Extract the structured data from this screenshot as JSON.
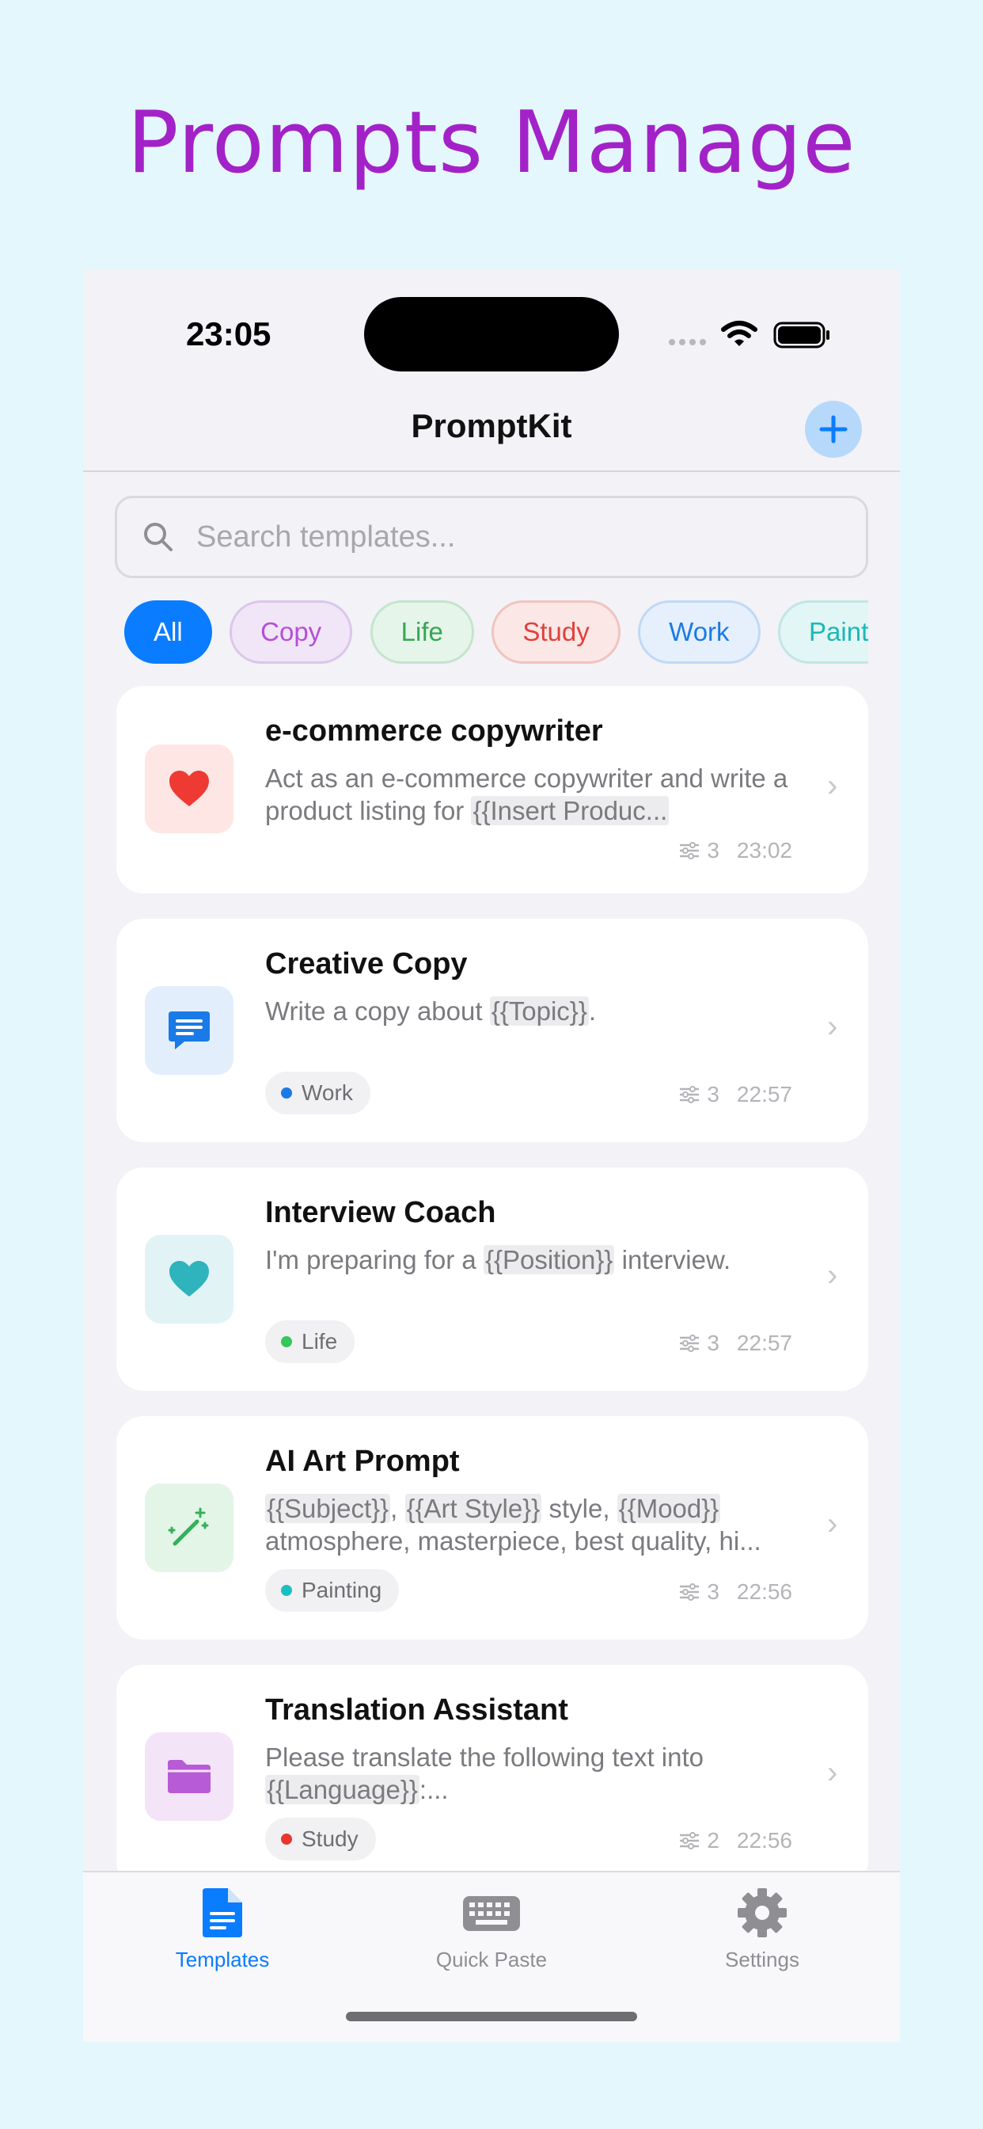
{
  "hero_title": "Prompts Manage",
  "status": {
    "time": "23:05"
  },
  "nav": {
    "title": "PromptKit"
  },
  "search": {
    "placeholder": "Search templates..."
  },
  "filters": [
    {
      "label": "All",
      "active": true
    },
    {
      "label": "Copy",
      "color": "#b44fd8",
      "bg": "#f1e6f7",
      "border": "#dcc6ea"
    },
    {
      "label": "Life",
      "color": "#34a853",
      "bg": "#e6f5ea",
      "border": "#c3e5cc"
    },
    {
      "label": "Study",
      "color": "#e0413a",
      "bg": "#fbe7e6",
      "border": "#f0c3c0"
    },
    {
      "label": "Work",
      "color": "#1a7ae6",
      "bg": "#e5f0fc",
      "border": "#c0d9f4"
    },
    {
      "label": "Painting",
      "color": "#1bb8b6",
      "bg": "#e2f6f5",
      "border": "#c0e6e5"
    }
  ],
  "templates": [
    {
      "title": "e-commerce copywriter",
      "desc_parts": [
        {
          "t": "Act as an e-commerce copywriter and write a product listing for "
        },
        {
          "t": "{{Insert Produc...",
          "ph": true
        }
      ],
      "variables": "3",
      "time": "23:02",
      "tag": null,
      "icon": "heart-icon",
      "icon_color": "#ee3a33",
      "icon_bg": "#fde6e4"
    },
    {
      "title": "Creative Copy",
      "desc_parts": [
        {
          "t": "Write a copy about "
        },
        {
          "t": "{{Topic}}",
          "ph": true
        },
        {
          "t": "."
        }
      ],
      "variables": "3",
      "time": "22:57",
      "tag": "Work",
      "tag_color": "#1a7ae6",
      "icon": "message-icon",
      "icon_color": "#1a7ae6",
      "icon_bg": "#e2eefb"
    },
    {
      "title": "Interview Coach",
      "desc_parts": [
        {
          "t": "I'm preparing for a "
        },
        {
          "t": "{{Position}}",
          "ph": true
        },
        {
          "t": " interview."
        }
      ],
      "variables": "3",
      "time": "22:57",
      "tag": "Life",
      "tag_color": "#34c759",
      "icon": "heart-icon",
      "icon_color": "#2fb3bd",
      "icon_bg": "#e1f3f5"
    },
    {
      "title": "AI Art Prompt",
      "desc_parts": [
        {
          "t": "{{Subject}}",
          "ph": true
        },
        {
          "t": ", "
        },
        {
          "t": "{{Art Style}}",
          "ph": true
        },
        {
          "t": " style, "
        },
        {
          "t": "{{Mood}}",
          "ph": true
        },
        {
          "t": " atmosphere, masterpiece, best quality, hi..."
        }
      ],
      "variables": "3",
      "time": "22:56",
      "tag": "Painting",
      "tag_color": "#1bbfbf",
      "icon": "magic-wand-icon",
      "icon_color": "#34b05a",
      "icon_bg": "#e3f5e7"
    },
    {
      "title": "Translation Assistant",
      "desc_parts": [
        {
          "t": "Please translate the following text into "
        },
        {
          "t": "{{Language}}",
          "ph": true
        },
        {
          "t": ":..."
        }
      ],
      "variables": "2",
      "time": "22:56",
      "tag": "Study",
      "tag_color": "#e8372f",
      "icon": "folder-icon",
      "icon_color": "#b75bd6",
      "icon_bg": "#f4e4f8"
    }
  ],
  "tabs": [
    {
      "label": "Templates",
      "icon": "document-icon",
      "active": true
    },
    {
      "label": "Quick Paste",
      "icon": "keyboard-icon",
      "active": false
    },
    {
      "label": "Settings",
      "icon": "gear-icon",
      "active": false
    }
  ],
  "colors": {
    "accent": "#0a7cff",
    "hero": "#a322c8",
    "inactive_tab": "#8e8e93"
  }
}
